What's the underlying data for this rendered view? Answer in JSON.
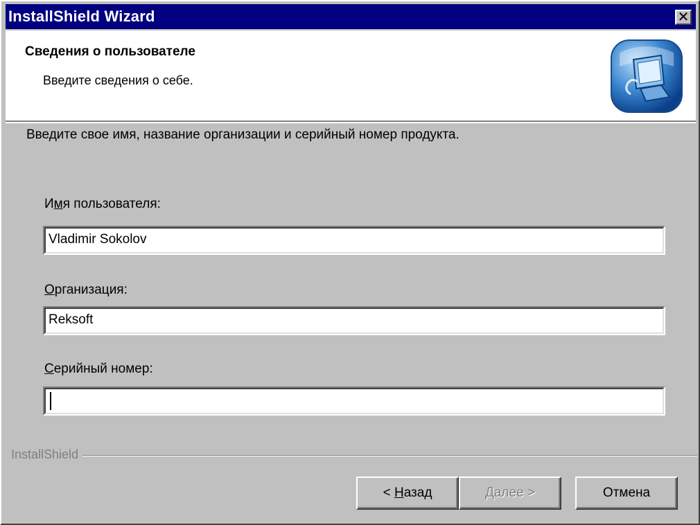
{
  "window": {
    "title": "InstallShield Wizard",
    "close_symbol": "✕"
  },
  "header": {
    "title": "Сведения о пользователе",
    "subtitle": "Введите сведения о себе.",
    "icon": "computer-setup-icon"
  },
  "body": {
    "instruction": "Введите свое имя, название организации и серийный номер продукта."
  },
  "fields": {
    "username": {
      "label_before": "И",
      "label_accel": "м",
      "label_after": "я пользователя:",
      "value": "Vladimir Sokolov"
    },
    "organization": {
      "label_before": "",
      "label_accel": "О",
      "label_after": "рганизация:",
      "value": "Reksoft"
    },
    "serial": {
      "label_before": "",
      "label_accel": "С",
      "label_after": "ерийный номер:",
      "value": ""
    }
  },
  "footer": {
    "brand": "InstallShield"
  },
  "buttons": {
    "back": {
      "before": "< ",
      "accel": "Н",
      "after": "азад"
    },
    "next": {
      "before": "",
      "accel": "Д",
      "after": "алее >",
      "enabled": false
    },
    "cancel": {
      "label": "Отмена"
    }
  },
  "colors": {
    "titlebar": "#000080",
    "face": "#c0c0c0",
    "header_bg": "#ffffff",
    "disabled_text": "#808080"
  }
}
